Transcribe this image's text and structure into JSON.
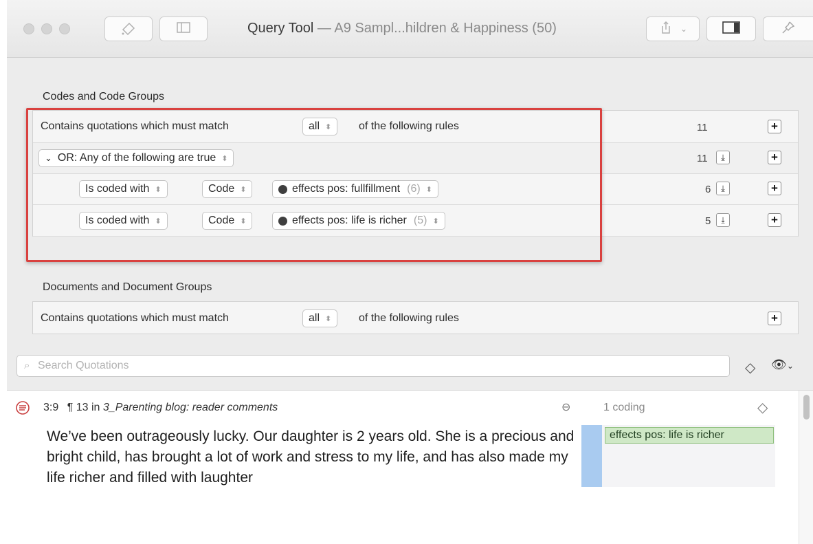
{
  "window": {
    "title": "Query Tool",
    "subtitle": "— A9 Sampl...hildren & Happiness (50)"
  },
  "codes_section": {
    "title": "Codes and Code Groups",
    "match_prefix": "Contains quotations which must match",
    "match_value": "all",
    "match_suffix": "of the following rules",
    "total_count": "11",
    "or_group": {
      "label": "OR: Any of the following are true",
      "count": "11"
    },
    "rules": [
      {
        "operator": "Is coded with",
        "type": "Code",
        "code": "effects pos: fullfillment",
        "freq": "(6)",
        "count": "6"
      },
      {
        "operator": "Is coded with",
        "type": "Code",
        "code": "effects pos: life is richer",
        "freq": "(5)",
        "count": "5"
      }
    ]
  },
  "documents_section": {
    "title": "Documents and Document Groups",
    "match_prefix": "Contains quotations which must match",
    "match_value": "all",
    "match_suffix": "of the following rules"
  },
  "search": {
    "placeholder": "Search Quotations"
  },
  "results": [
    {
      "id": "3:9",
      "para": "¶ 13 in",
      "document": "3_Parenting blog: reader comments",
      "codings": "1 coding",
      "text": "We’ve been outrageously lucky. Our daughter is 2 years old. She is a precious and bright child, has brought a lot of work and stress to my life, and has also made my life richer and filled with laughter",
      "code_chip": "effects pos: life is richer"
    }
  ],
  "colors": {
    "highlight_border": "#d9413f",
    "code_chip_bg": "#cfe8c6",
    "margin_bar": "#a9cbf0"
  }
}
